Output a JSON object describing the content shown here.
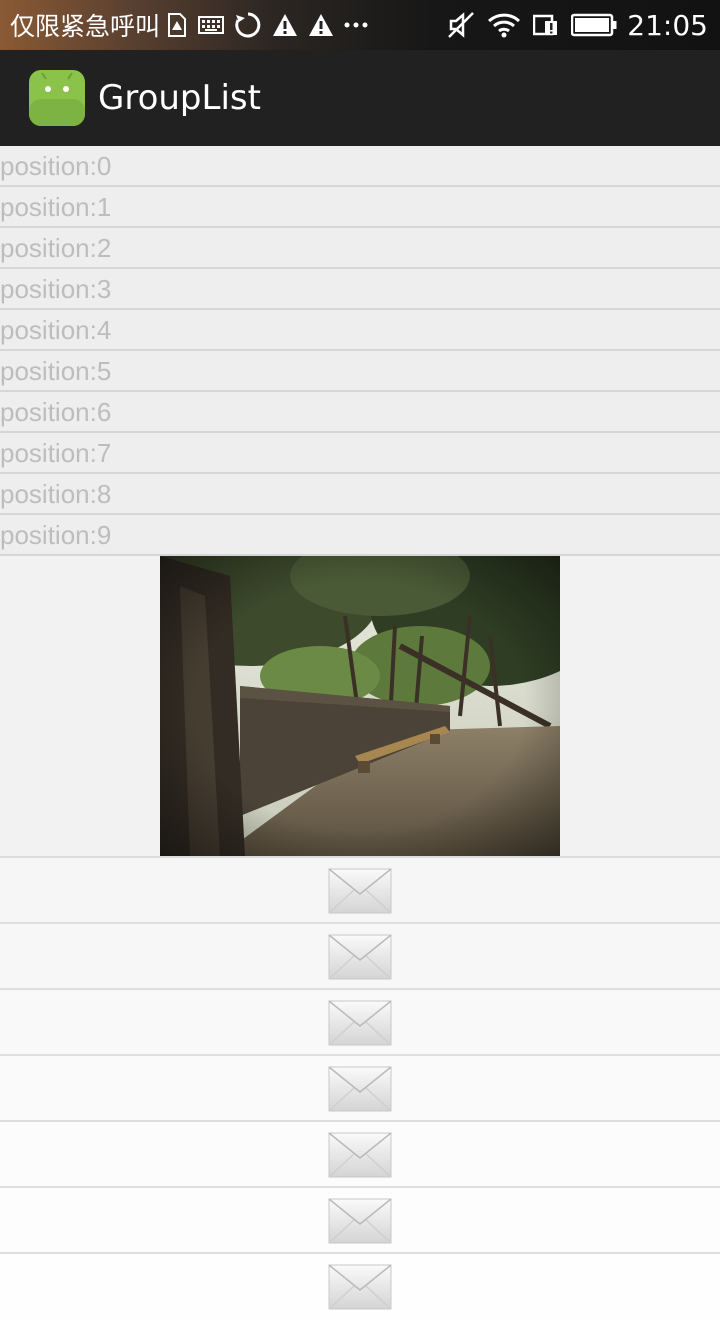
{
  "status_bar": {
    "carrier": "仅限紧急呼叫",
    "time": "21:05",
    "left_icons": [
      "sim-warning-icon",
      "keyboard-icon",
      "sync-icon",
      "warning-icon",
      "warning-icon",
      "more-icon"
    ],
    "right_icons": [
      "mute-icon",
      "wifi-icon",
      "sim-icon",
      "battery-icon"
    ]
  },
  "app_bar": {
    "title": "GroupList",
    "icon": "android-icon"
  },
  "list": {
    "items": [
      {
        "label": "position:0"
      },
      {
        "label": "position:1"
      },
      {
        "label": "position:2"
      },
      {
        "label": "position:3"
      },
      {
        "label": "position:4"
      },
      {
        "label": "position:5"
      },
      {
        "label": "position:6"
      },
      {
        "label": "position:7"
      },
      {
        "label": "position:8"
      },
      {
        "label": "position:9"
      }
    ],
    "photo": "park-photo",
    "mail_rows": 7,
    "mail_icon": "envelope-icon"
  },
  "colors": {
    "appbar": "#212121",
    "row_bg": "#eeeeee",
    "row_text": "#bdbdbd",
    "divider": "#d6d6d6"
  }
}
